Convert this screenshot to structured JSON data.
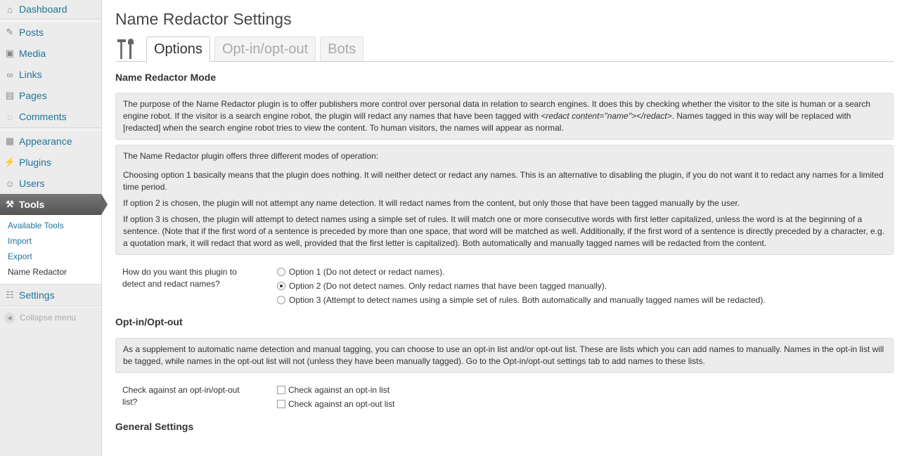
{
  "sidebar": {
    "items": [
      {
        "label": "Dashboard",
        "icon": "home-icon"
      },
      {
        "label": "Posts",
        "icon": "pin-icon"
      },
      {
        "label": "Media",
        "icon": "media-icon"
      },
      {
        "label": "Links",
        "icon": "link-icon"
      },
      {
        "label": "Pages",
        "icon": "page-icon"
      },
      {
        "label": "Comments",
        "icon": "comment-icon"
      },
      {
        "label": "Appearance",
        "icon": "appearance-icon"
      },
      {
        "label": "Plugins",
        "icon": "plugin-icon"
      },
      {
        "label": "Users",
        "icon": "users-icon"
      },
      {
        "label": "Tools",
        "icon": "tools-icon"
      },
      {
        "label": "Settings",
        "icon": "settings-icon"
      }
    ],
    "submenu": [
      "Available Tools",
      "Import",
      "Export",
      "Name Redactor"
    ],
    "collapse_label": "Collapse menu"
  },
  "page": {
    "title": "Name Redactor Settings",
    "tabs": [
      "Options",
      "Opt-in/opt-out",
      "Bots"
    ]
  },
  "mode_section": {
    "heading": "Name Redactor Mode",
    "intro_pre": "The purpose of the Name Redactor plugin is to offer publishers more control over personal data in relation to search engines. It does this by checking whether the visitor to the site is human or a search engine robot. If the visitor is a search engine robot, the plugin will redact any names that have been tagged with ",
    "intro_code": "<redact content=\"name\"></redact>",
    "intro_post": ". Names tagged in this way will be replaced with [redacted] when the search engine robot tries to view the content. To human visitors, the names will appear as normal.",
    "modes_intro": "The Name Redactor plugin offers three different modes of operation:",
    "mode1": "Choosing option 1 basically means that the plugin does nothing. It will neither detect or redact any names. This is an alternative to disabling the plugin, if you do not want it to redact any names for a limited time period.",
    "mode2": "If option 2 is chosen, the plugin will not attempt any name detection. It will redact names from the content, but only those that have been tagged manually by the user.",
    "mode3": "If option 3 is chosen, the plugin will attempt to detect names using a simple set of rules. It will match one or more consecutive words with first letter capitalized, unless the word is at the beginning of a sentence. (Note that if the first word of a sentence is preceded by more than one space, that word will be matched as well. Additionally, if the first word of a sentence is directly preceded by a character, e.g. a quotation mark, it will redact that word as well, provided that the first letter is capitalized). Both automatically and manually tagged names will be redacted from the content.",
    "question": "How do you want this plugin to detect and redact names?",
    "options": [
      "Option 1 (Do not detect or redact names).",
      "Option 2 (Do not detect names. Only redact names that have been tagged manually).",
      "Option 3 (Attempt to detect names using a simple set of rules. Both automatically and manually tagged names will be redacted)."
    ],
    "selected": 1
  },
  "optin_section": {
    "heading": "Opt-in/Opt-out",
    "description": "As a supplement to automatic name detection and manual tagging, you can choose to use an opt-in list and/or opt-out list. These are lists which you can add names to manually. Names in the opt-in list will be tagged, while names in the opt-out list will not (unless they have been manually tagged). Go to the Opt-in/opt-out settings tab to add names to these lists.",
    "question": "Check against an opt-in/opt-out list?",
    "checkboxes": [
      "Check against an opt-in list",
      "Check against an opt-out list"
    ]
  },
  "general_section": {
    "heading": "General Settings"
  }
}
